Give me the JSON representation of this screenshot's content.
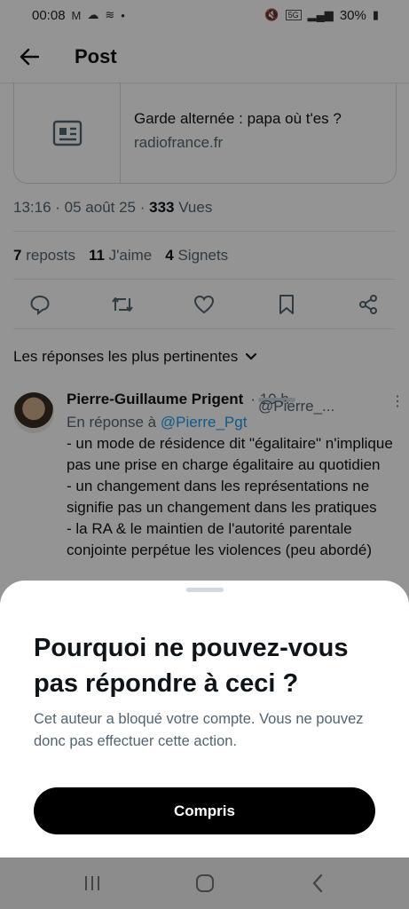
{
  "status_bar": {
    "time": "00:08",
    "battery": "30%",
    "signal_badge": "5G"
  },
  "header": {
    "title": "Post"
  },
  "link_card": {
    "headline": "Garde alternée : papa où t'es ?",
    "domain": "radiofrance.fr"
  },
  "post_meta": {
    "time_date": "13:16 · 05 août 25 · ",
    "views_count": "333",
    "views_label": " Vues"
  },
  "stats": [
    {
      "count": "7",
      "label": "reposts"
    },
    {
      "count": "11",
      "label": "J'aime"
    },
    {
      "count": "4",
      "label": "Signets"
    }
  ],
  "sort_label": "Les réponses les plus pertinentes",
  "reply": {
    "name": "Pierre-Guillaume Prigent",
    "handle": "@Pierre_...",
    "time": "· 10 h",
    "in_reply_prefix": "En réponse à ",
    "in_reply_handle": "@Pierre_Pgt",
    "lines": [
      "- un mode de résidence dit \"égalitaire\" n'implique pas une prise en charge égalitaire au quotidien",
      "- un changement dans les représentations ne signifie pas un changement dans les pratiques",
      "- la RA & le maintien de l'autorité parentale conjointe perpétue les violences (peu abordé)"
    ]
  },
  "sheet": {
    "heading": "Pourquoi ne pouvez-vous pas répondre à ceci ?",
    "description": "Cet auteur a bloqué votre compte. Vous ne pouvez donc pas effectuer cette action.",
    "button_label": "Compris"
  },
  "icons": {
    "back": "arrow-left-icon",
    "article": "article-icon",
    "reply": "reply-icon",
    "repost": "repost-icon",
    "like": "heart-icon",
    "bookmark": "bookmark-icon",
    "share": "share-icon",
    "chevron": "chevron-down-icon",
    "more": "more-vertical-icon"
  }
}
